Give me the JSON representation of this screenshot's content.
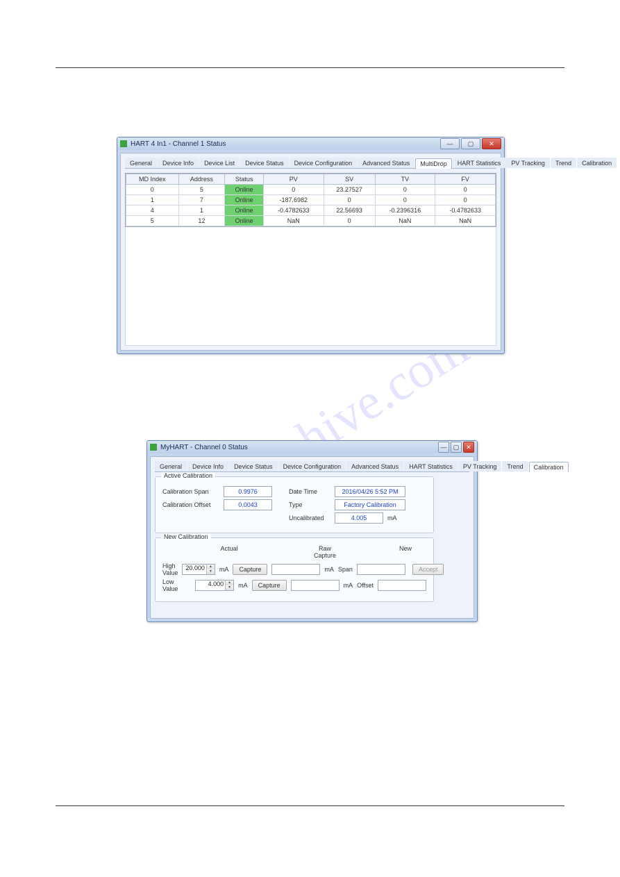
{
  "watermark_text": "manualshive.com",
  "window1": {
    "title": "HART 4 In1 - Channel 1 Status",
    "tabs": [
      "General",
      "Device Info",
      "Device List",
      "Device Status",
      "Device Configuration",
      "Advanced Status",
      "MultiDrop",
      "HART Statistics",
      "PV Tracking",
      "Trend",
      "Calibration"
    ],
    "active_tab": "MultiDrop",
    "columns": [
      "MD Index",
      "Address",
      "Status",
      "PV",
      "SV",
      "TV",
      "FV"
    ],
    "rows": [
      {
        "idx": "0",
        "addr": "5",
        "status": "Online",
        "pv": "0",
        "sv": "23.27527",
        "tv": "0",
        "fv": "0"
      },
      {
        "idx": "1",
        "addr": "7",
        "status": "Online",
        "pv": "-187.6982",
        "sv": "0",
        "tv": "0",
        "fv": "0"
      },
      {
        "idx": "4",
        "addr": "1",
        "status": "Online",
        "pv": "-0.4782633",
        "sv": "22.56693",
        "tv": "-0.2396316",
        "fv": "-0.4782633"
      },
      {
        "idx": "5",
        "addr": "12",
        "status": "Online",
        "pv": "NaN",
        "sv": "0",
        "tv": "NaN",
        "fv": "NaN"
      }
    ]
  },
  "window2": {
    "title": "MyHART - Channel 0 Status",
    "tabs": [
      "General",
      "Device Info",
      "Device Status",
      "Device Configuration",
      "Advanced Status",
      "HART Statistics",
      "PV Tracking",
      "Trend",
      "Calibration"
    ],
    "active_tab": "Calibration",
    "active_group_title": "Active Calibration",
    "labels": {
      "cal_span": "Calibration Span",
      "cal_offset": "Calibration Offset",
      "datetime": "Date Time",
      "type": "Type",
      "uncal": "Uncalibrated",
      "uncal_unit": "mA"
    },
    "values": {
      "cal_span": "0.9976",
      "cal_offset": "0.0043",
      "datetime": "2016/04/26 5:52 PM",
      "type": "Factory Calibration",
      "uncal": "4.005"
    },
    "new_group_title": "New Calibration",
    "col_headers": {
      "actual": "Actual",
      "raw": "Raw Capture",
      "new": "New"
    },
    "new_labels": {
      "high": "High Value",
      "low": "Low Value",
      "span": "Span",
      "offset": "Offset",
      "unit": "mA",
      "capture": "Capture",
      "accept": "Accept"
    },
    "new_values": {
      "high_actual": "20.000",
      "low_actual": "4.000"
    }
  },
  "winctrl": {
    "min": "—",
    "max": "▢",
    "close": "✕"
  }
}
